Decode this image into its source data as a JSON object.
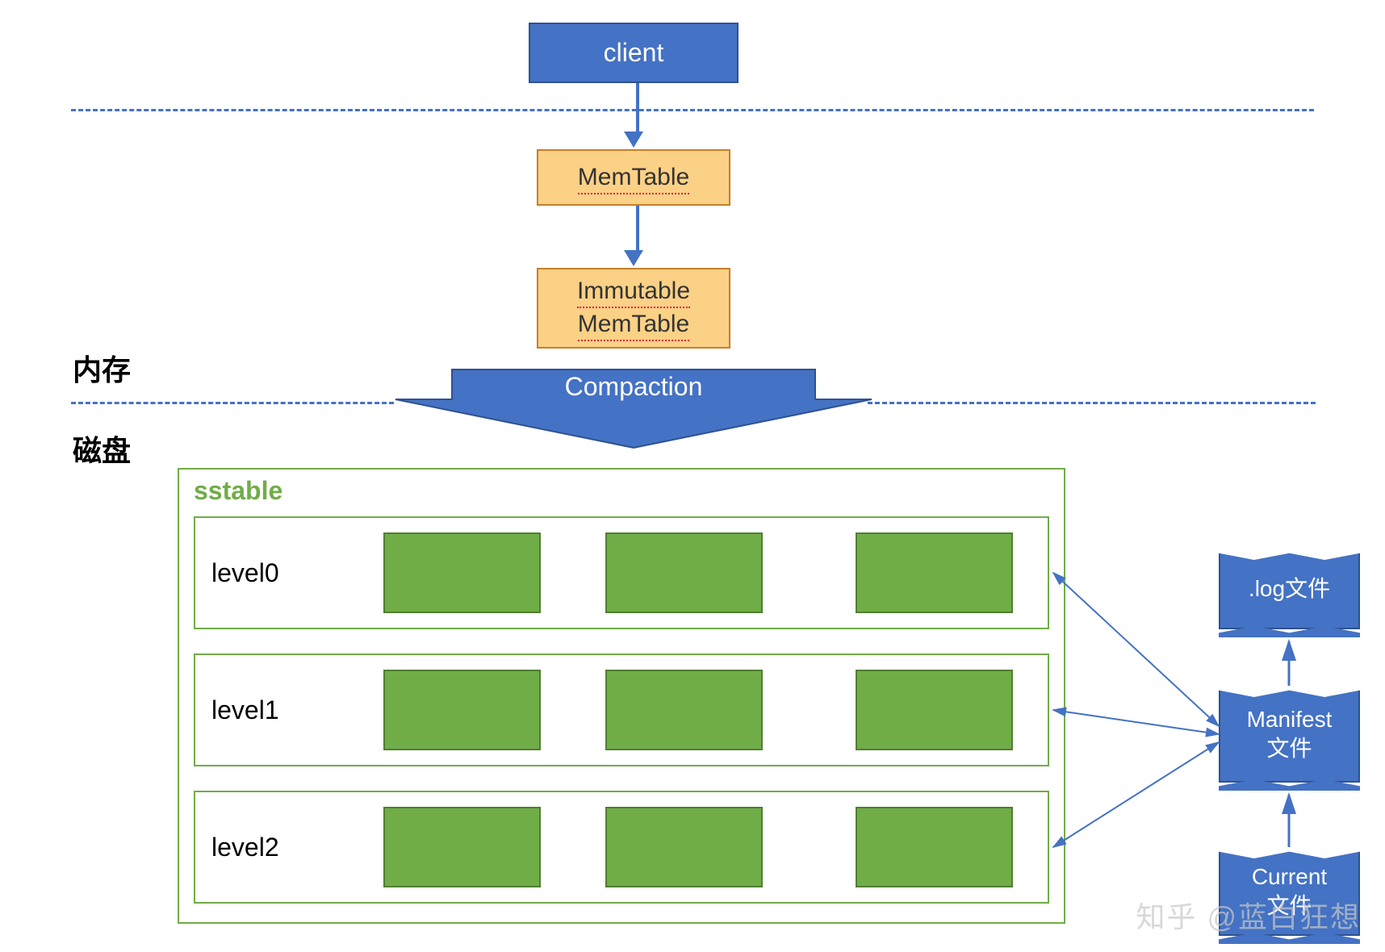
{
  "nodes": {
    "client": "client",
    "memtable": "MemTable",
    "immutable_line1": "Immutable",
    "immutable_line2": "MemTable",
    "compaction": "Compaction"
  },
  "sections": {
    "memory": "内存",
    "disk": "磁盘"
  },
  "sstable": {
    "title": "sstable",
    "levels": [
      "level0",
      "level1",
      "level2"
    ]
  },
  "files": {
    "log": ".log文件",
    "manifest_line1": "Manifest",
    "manifest_line2": "文件",
    "current_line1": "Current",
    "current_line2": "文件"
  },
  "watermark": "知乎 @蓝白狂想"
}
